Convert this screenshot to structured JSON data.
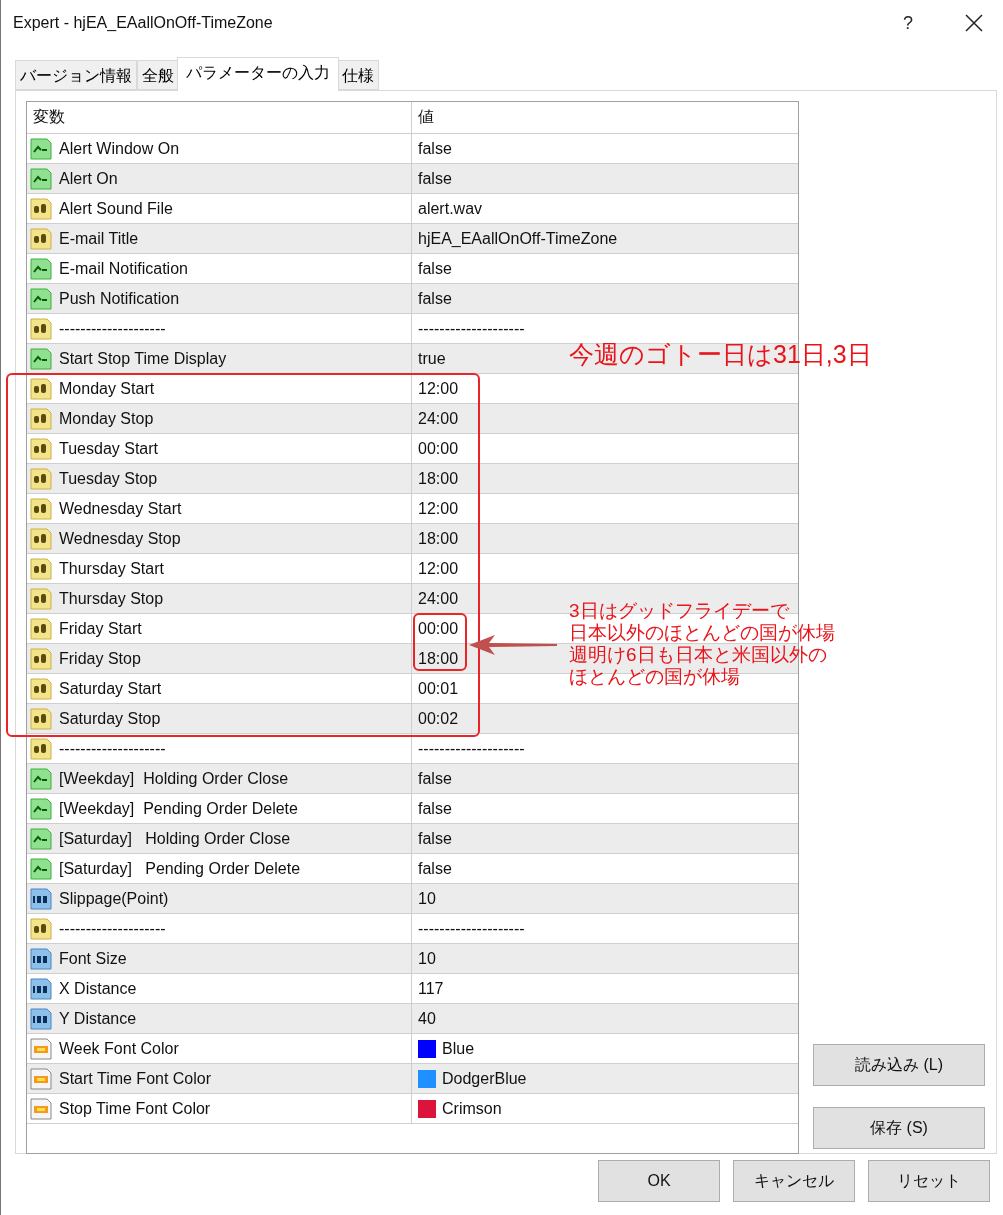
{
  "window": {
    "title": "Expert - hjEA_EAallOnOff-TimeZone",
    "help": "?"
  },
  "tabs": [
    {
      "label": "バージョン情報",
      "selected": false
    },
    {
      "label": "全般",
      "selected": false
    },
    {
      "label": "パラメーターの入力",
      "selected": true
    },
    {
      "label": "仕様",
      "selected": false
    }
  ],
  "table": {
    "columns": [
      "変数",
      "値"
    ],
    "rows": [
      {
        "kind": "bool",
        "name": "Alert Window On",
        "value": "false"
      },
      {
        "kind": "bool",
        "name": "Alert On",
        "value": "false"
      },
      {
        "kind": "text",
        "name": "Alert Sound File",
        "value": "alert.wav"
      },
      {
        "kind": "text",
        "name": "E-mail Title",
        "value": "hjEA_EAallOnOff-TimeZone"
      },
      {
        "kind": "bool",
        "name": "E-mail Notification",
        "value": "false"
      },
      {
        "kind": "bool",
        "name": "Push Notification",
        "value": "false"
      },
      {
        "kind": "text",
        "name": "--------------------",
        "value": "--------------------"
      },
      {
        "kind": "bool",
        "name": "Start Stop Time Display",
        "value": "true"
      },
      {
        "kind": "text",
        "name": "Monday Start",
        "value": "12:00"
      },
      {
        "kind": "text",
        "name": "Monday Stop",
        "value": "24:00"
      },
      {
        "kind": "text",
        "name": "Tuesday Start",
        "value": "00:00"
      },
      {
        "kind": "text",
        "name": "Tuesday Stop",
        "value": "18:00"
      },
      {
        "kind": "text",
        "name": "Wednesday Start",
        "value": "12:00"
      },
      {
        "kind": "text",
        "name": "Wednesday Stop",
        "value": "18:00"
      },
      {
        "kind": "text",
        "name": "Thursday Start",
        "value": "12:00"
      },
      {
        "kind": "text",
        "name": "Thursday Stop",
        "value": "24:00"
      },
      {
        "kind": "text",
        "name": "Friday Start",
        "value": "00:00"
      },
      {
        "kind": "text",
        "name": "Friday Stop",
        "value": "18:00"
      },
      {
        "kind": "text",
        "name": "Saturday Start",
        "value": "00:01"
      },
      {
        "kind": "text",
        "name": "Saturday Stop",
        "value": "00:02"
      },
      {
        "kind": "text",
        "name": "--------------------",
        "value": "--------------------"
      },
      {
        "kind": "bool",
        "name": "[Weekday]  Holding Order Close",
        "value": "false"
      },
      {
        "kind": "bool",
        "name": "[Weekday]  Pending Order Delete",
        "value": "false"
      },
      {
        "kind": "bool",
        "name": "[Saturday]   Holding Order Close",
        "value": "false"
      },
      {
        "kind": "bool",
        "name": "[Saturday]   Pending Order Delete",
        "value": "false"
      },
      {
        "kind": "int",
        "name": "Slippage(Point)",
        "value": "10"
      },
      {
        "kind": "text",
        "name": "--------------------",
        "value": "--------------------"
      },
      {
        "kind": "int",
        "name": "Font Size",
        "value": "10"
      },
      {
        "kind": "int",
        "name": "X Distance",
        "value": "117"
      },
      {
        "kind": "int",
        "name": "Y Distance",
        "value": "40"
      },
      {
        "kind": "color",
        "name": "Week Font Color",
        "value": "Blue",
        "color": "#0000ff"
      },
      {
        "kind": "color",
        "name": "Start Time Font Color",
        "value": "DodgerBlue",
        "color": "#1e90ff"
      },
      {
        "kind": "color",
        "name": "Stop Time Font Color",
        "value": "Crimson",
        "color": "#dc143c"
      }
    ]
  },
  "side_buttons": [
    "読み込み (L)",
    "保存 (S)"
  ],
  "buttons": [
    "OK",
    "キャンセル",
    "リセット"
  ],
  "annotations": {
    "headline": "今週のゴトー日は31日,3日",
    "note": [
      "3日はグッドフライデーで",
      "日本以外のほとんどの国が休場",
      "週明け6日も日本と米国以外の",
      "ほとんどの国が休場"
    ]
  }
}
